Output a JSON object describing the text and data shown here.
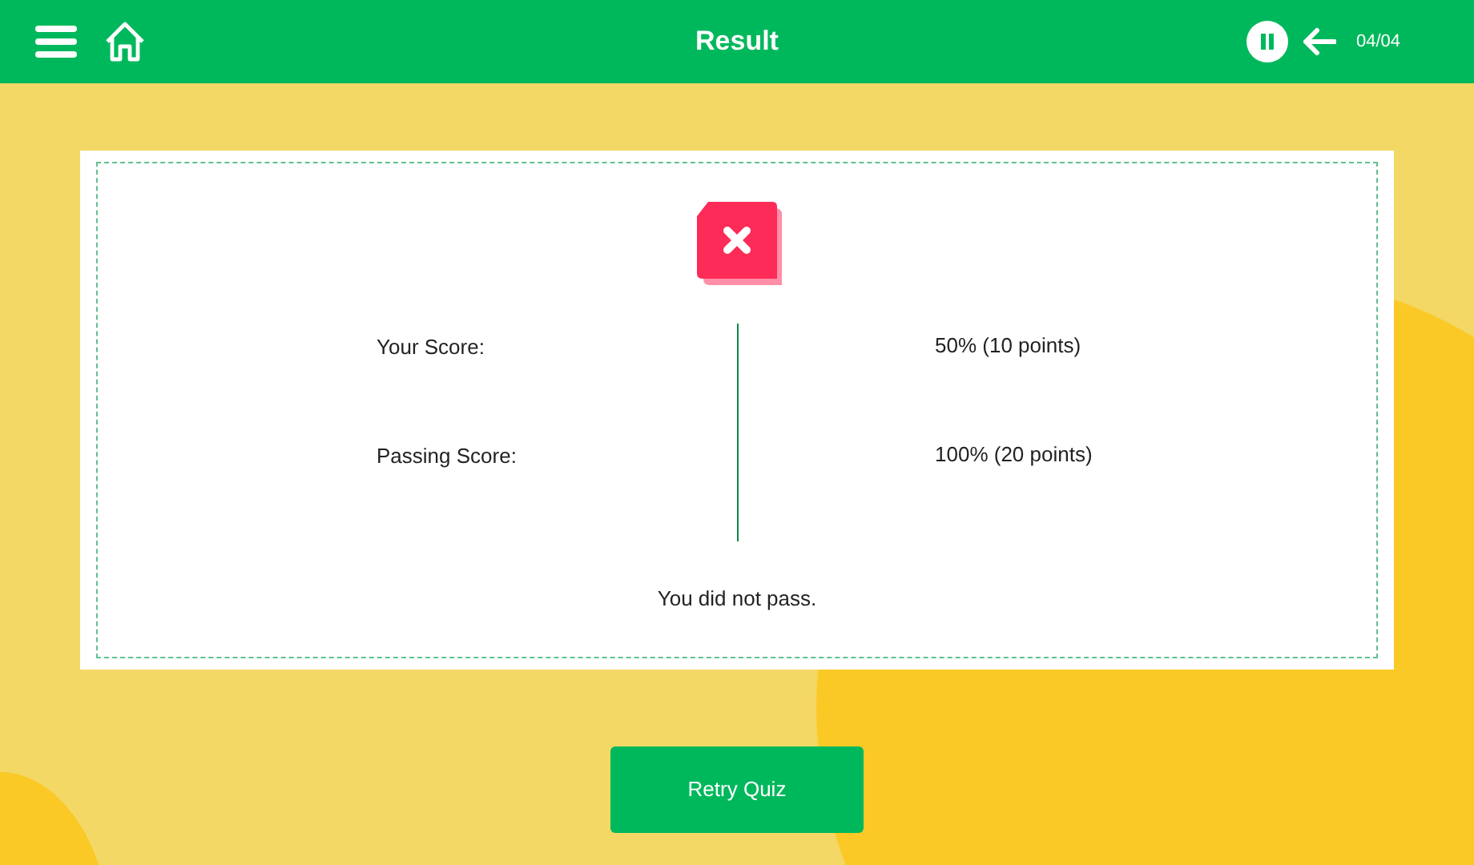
{
  "header": {
    "title": "Result",
    "progress": "04/04"
  },
  "result": {
    "passed": false,
    "rows": [
      {
        "label": "Your Score:",
        "value": "50% (10 points)"
      },
      {
        "label": "Passing Score:",
        "value": "100% (20 points)"
      }
    ],
    "message": "You did not pass."
  },
  "buttons": [
    "Retry Quiz"
  ]
}
